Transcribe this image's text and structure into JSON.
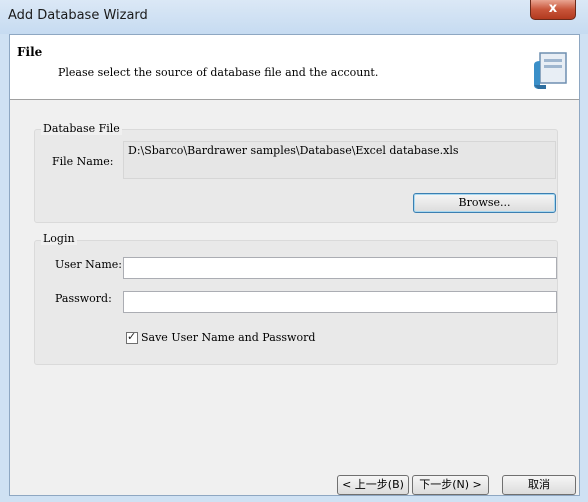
{
  "window": {
    "title": "Add Database Wizard",
    "close_glyph": "x"
  },
  "header": {
    "title": "File",
    "subtitle": "Please select the source of database file and the account."
  },
  "database_file": {
    "group_label": "Database File",
    "file_name_label": "File Name:",
    "file_path": "D:\\Sbarco\\Bardrawer samples\\Database\\Excel database.xls",
    "browse_label": "Browse..."
  },
  "login": {
    "group_label": "Login",
    "user_name_label": "User Name:",
    "user_name_value": "",
    "password_label": "Password:",
    "password_value": "",
    "save_checked": true,
    "check_glyph": "✓",
    "save_label": "Save User Name and Password"
  },
  "footer": {
    "back_label": "< 上一步(B)",
    "next_label": "下一步(N) >",
    "cancel_label": "取消"
  },
  "colors": {
    "titlebar": "#cfe1f3",
    "close": "#c8553a",
    "dialog": "#f0f0f0"
  },
  "icons": [
    "close-icon",
    "wizard-icon",
    "check-icon"
  ]
}
